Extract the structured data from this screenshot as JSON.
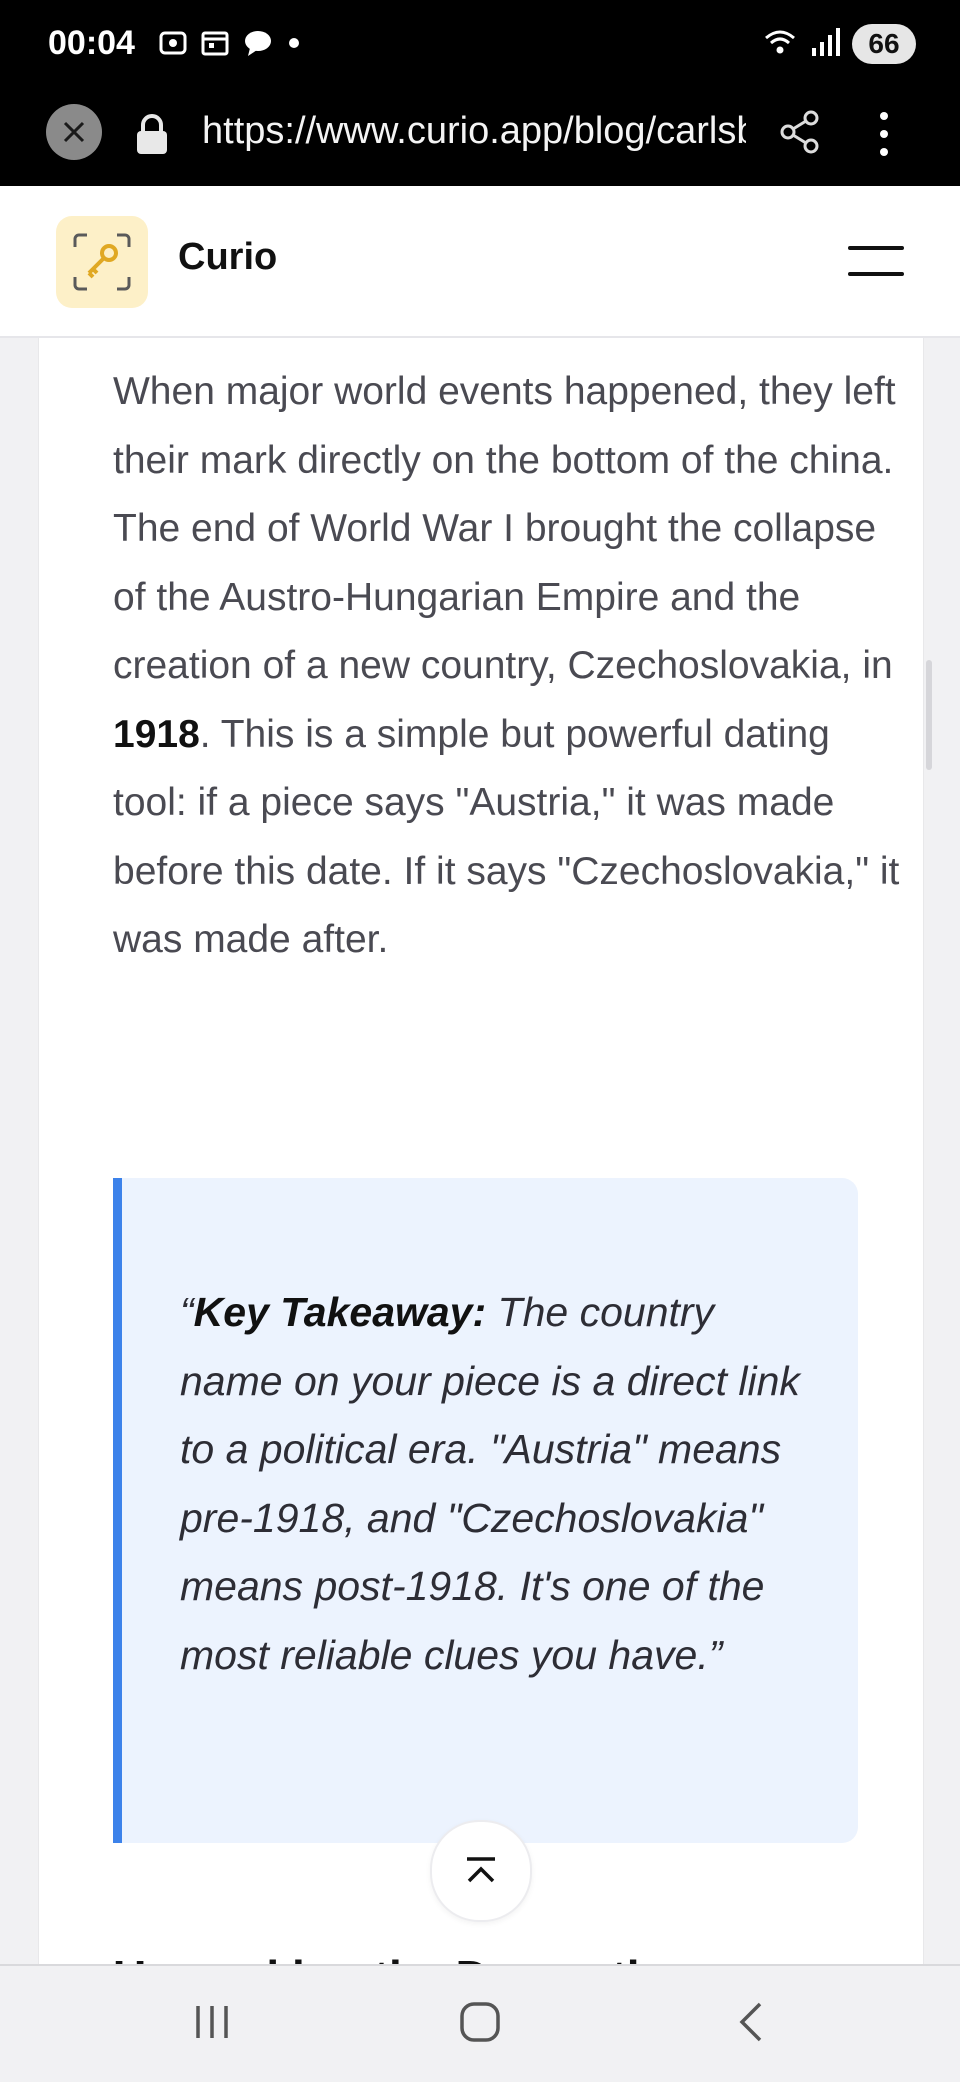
{
  "status_bar": {
    "time": "00:04",
    "battery": "66",
    "icons": [
      "screenshot-icon",
      "calendar-icon",
      "chat-bubble-icon",
      "dot-icon",
      "wifi-icon",
      "signal-icon"
    ]
  },
  "browser": {
    "url": "https://www.curio.app/blog/carlsbad-austria-czechoslovakia-china-marks"
  },
  "site": {
    "brand": "Curio",
    "logo_color": "#fdf0c8",
    "accent": "#e0a823"
  },
  "article": {
    "paragraph_before": "When major world events happened, they left their mark directly on the bottom of the china. The end of World War I brought the collapse of the Austro-Hungarian Empire and the creation of a new country, Czechoslovakia, in ",
    "paragraph_bold": "1918",
    "paragraph_after": ". This is a simple but powerful dating tool: if a piece says \"Austria,\" it was made before this date. If it says \"Czechoslovakia,\" it was made after.",
    "quote_open": "“",
    "quote_label": "Key Takeaway:",
    "quote_text": " The country name on your piece is a direct link to a political era. \"Austria\" means pre-1918, and \"Czechoslovakia\" means post-1918. It's one of the most reliable clues you have.",
    "quote_close": "”",
    "quote_accent": "#3c82ea",
    "next_heading": "Unmasking the Decorati"
  }
}
